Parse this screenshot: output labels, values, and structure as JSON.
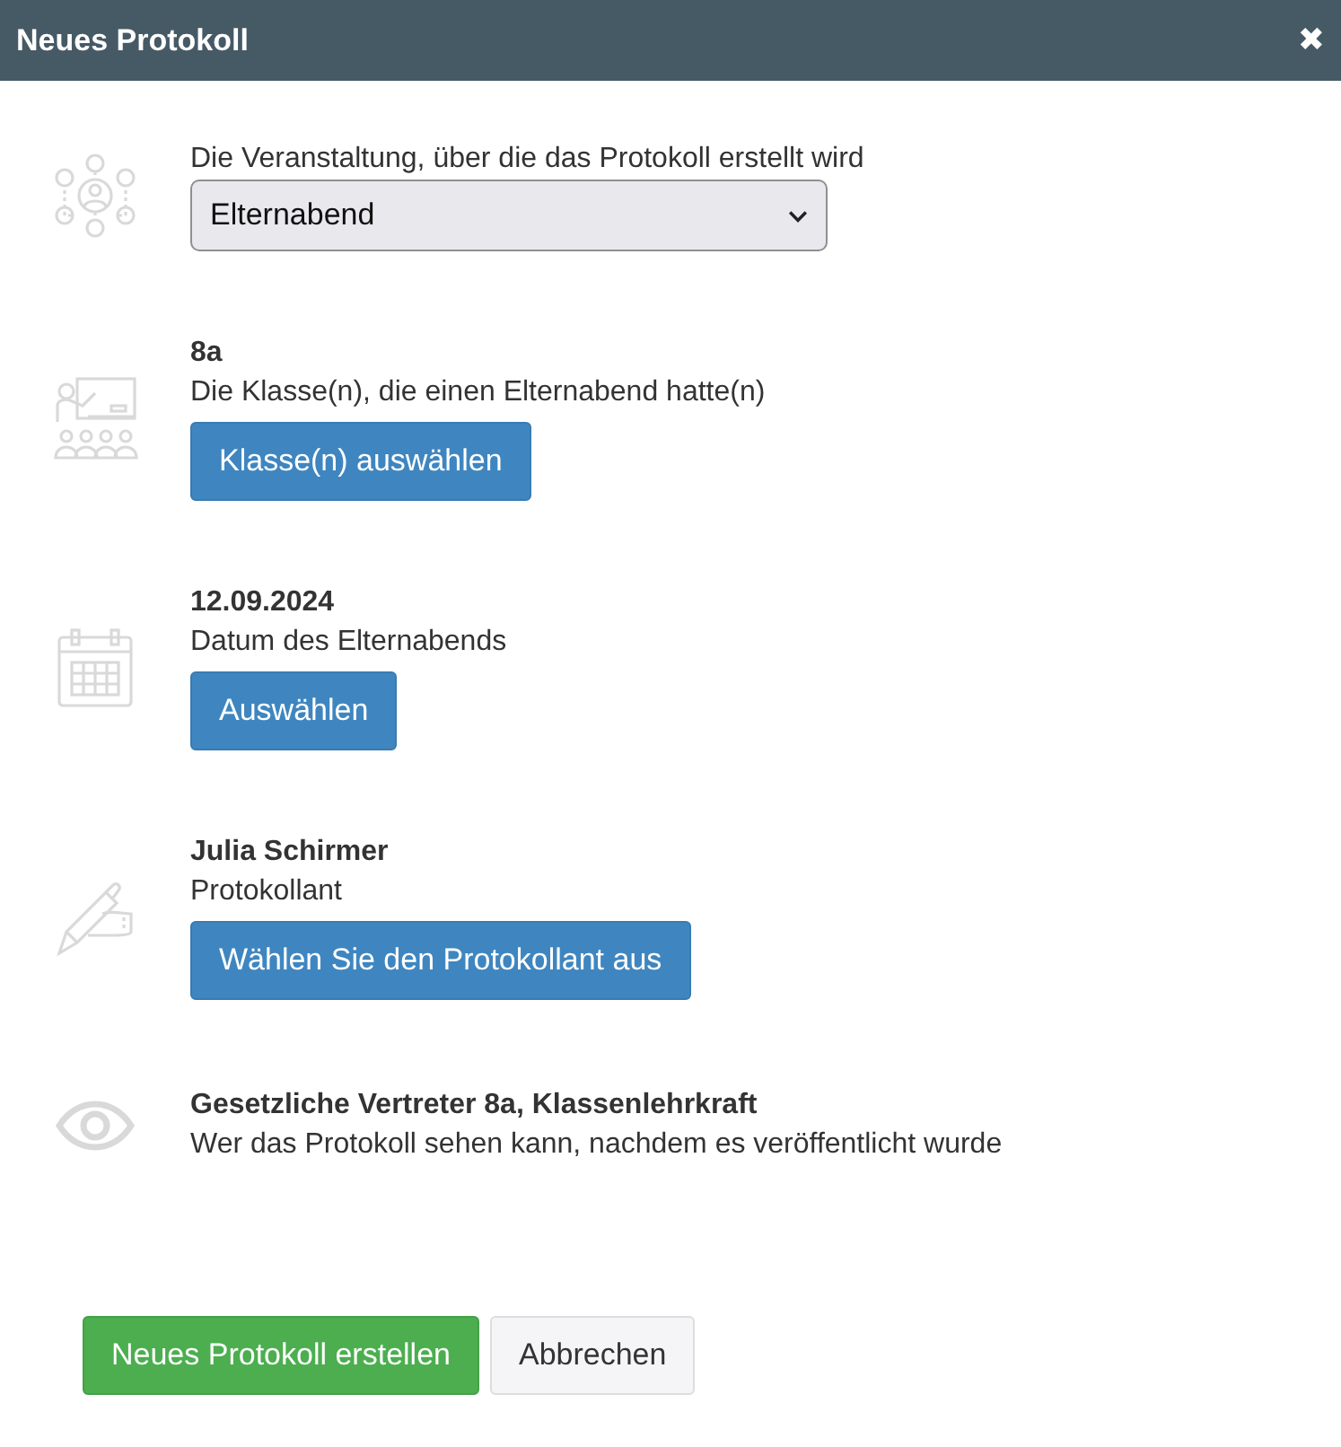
{
  "window": {
    "title": "Neues Protokoll",
    "close": "✖"
  },
  "sections": [
    {
      "kind": "select",
      "label": "Die Veranstaltung, über die das Protokoll erstellt wird",
      "value": "Elternabend"
    },
    {
      "kind": "choice",
      "value": "8a",
      "label": "Die Klasse(n), die einen Elternabend hatte(n)",
      "button": "Klasse(n) auswählen"
    },
    {
      "kind": "choice",
      "value": "12.09.2024",
      "label": "Datum des Elternabends",
      "button": "Auswählen"
    },
    {
      "kind": "choice",
      "value": "Julia Schirmer",
      "label": "Protokollant",
      "button": "Wählen Sie den Protokollant aus"
    },
    {
      "kind": "info",
      "value": "Gesetzliche Vertreter 8a, Klassenlehrkraft",
      "label": "Wer das Protokoll sehen kann, nachdem es veröffentlicht wurde"
    }
  ],
  "buttons": [
    {
      "label": "Neues Protokoll erstellen",
      "kind": "primary"
    },
    {
      "label": "Abbrechen",
      "kind": "secondary"
    }
  ]
}
